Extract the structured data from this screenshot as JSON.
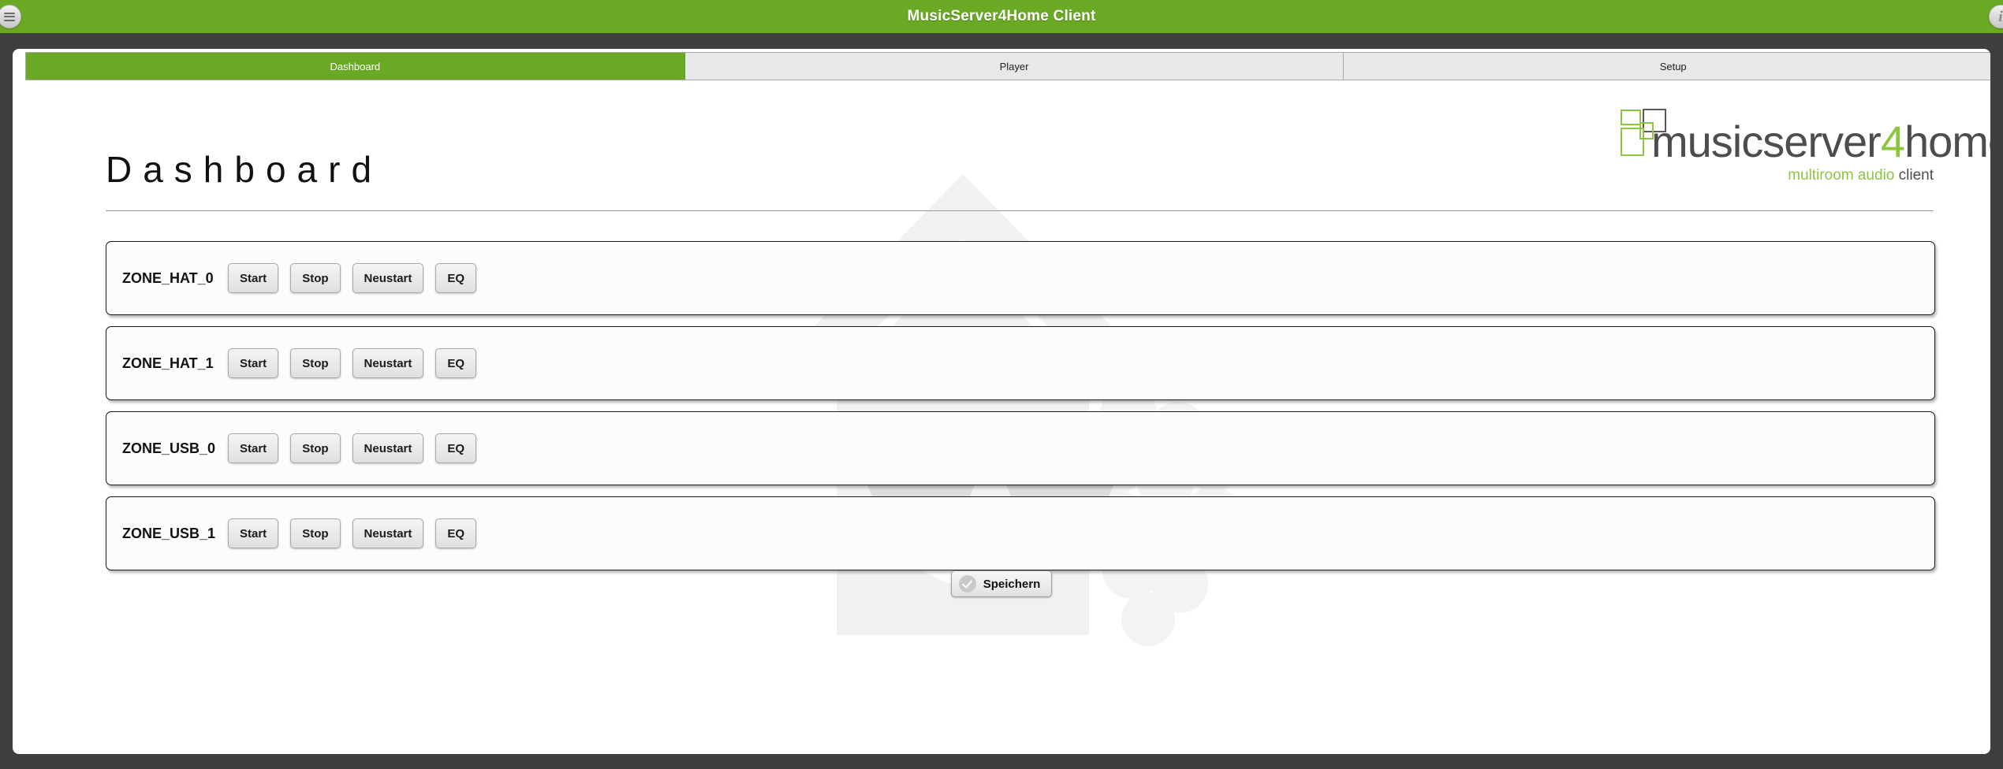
{
  "window": {
    "title": "MusicServer4Home Client",
    "menu_icon": "hamburger-menu-icon",
    "info_icon": "info-icon",
    "titlebar_color": "#6aa924",
    "chrome_color": "#3e3e3e"
  },
  "tabs": [
    {
      "label": "Dashboard",
      "active": true
    },
    {
      "label": "Player",
      "active": false
    },
    {
      "label": "Setup",
      "active": false
    }
  ],
  "page": {
    "heading": "Dashboard"
  },
  "logo": {
    "word_main": "musicserver",
    "word_four": "4",
    "word_tail": "home",
    "tagline_green": "multiroom audio",
    "tagline_gray": "client",
    "accent_color": "#8cc63f",
    "text_color": "#4d4d4d"
  },
  "zones": [
    {
      "name": "ZONE_HAT_0",
      "buttons": [
        "Start",
        "Stop",
        "Neustart",
        "EQ"
      ]
    },
    {
      "name": "ZONE_HAT_1",
      "buttons": [
        "Start",
        "Stop",
        "Neustart",
        "EQ"
      ]
    },
    {
      "name": "ZONE_USB_0",
      "buttons": [
        "Start",
        "Stop",
        "Neustart",
        "EQ"
      ]
    },
    {
      "name": "ZONE_USB_1",
      "buttons": [
        "Start",
        "Stop",
        "Neustart",
        "EQ"
      ]
    }
  ],
  "save": {
    "label": "Speichern",
    "icon": "check-circle-icon"
  },
  "watermark": {
    "description": "house-with-sunglasses-and-raspberry",
    "color": "#f1f1f1"
  }
}
